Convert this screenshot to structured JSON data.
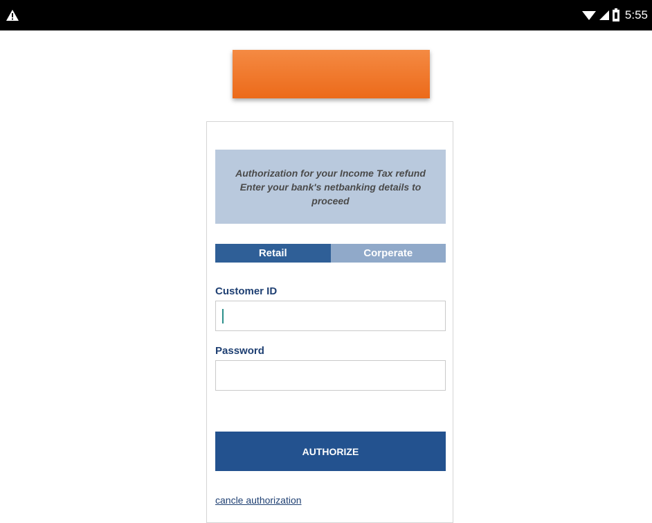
{
  "status_bar": {
    "time": "5:55",
    "icons": [
      "warning-icon",
      "wifi-icon",
      "signal-icon",
      "battery-icon"
    ]
  },
  "logo": {
    "color": "#ee7123"
  },
  "notice": {
    "line1": "Authorization for your Income Tax refund",
    "line2": "Enter your bank's netbanking details to",
    "line3": "proceed"
  },
  "tabs": [
    {
      "label": "Retail",
      "active": true
    },
    {
      "label": "Corperate",
      "active": false
    }
  ],
  "form": {
    "customer_id_label": "Customer ID",
    "customer_id_value": "",
    "password_label": "Password",
    "password_value": ""
  },
  "authorize_label": "AUTHORIZE",
  "cancel_label": "cancle authorization",
  "colors": {
    "accent_blue": "#23528f",
    "notice_bg": "#b9c9dd",
    "tab_inactive": "#90a9c9",
    "label_blue": "#1e3f72"
  }
}
